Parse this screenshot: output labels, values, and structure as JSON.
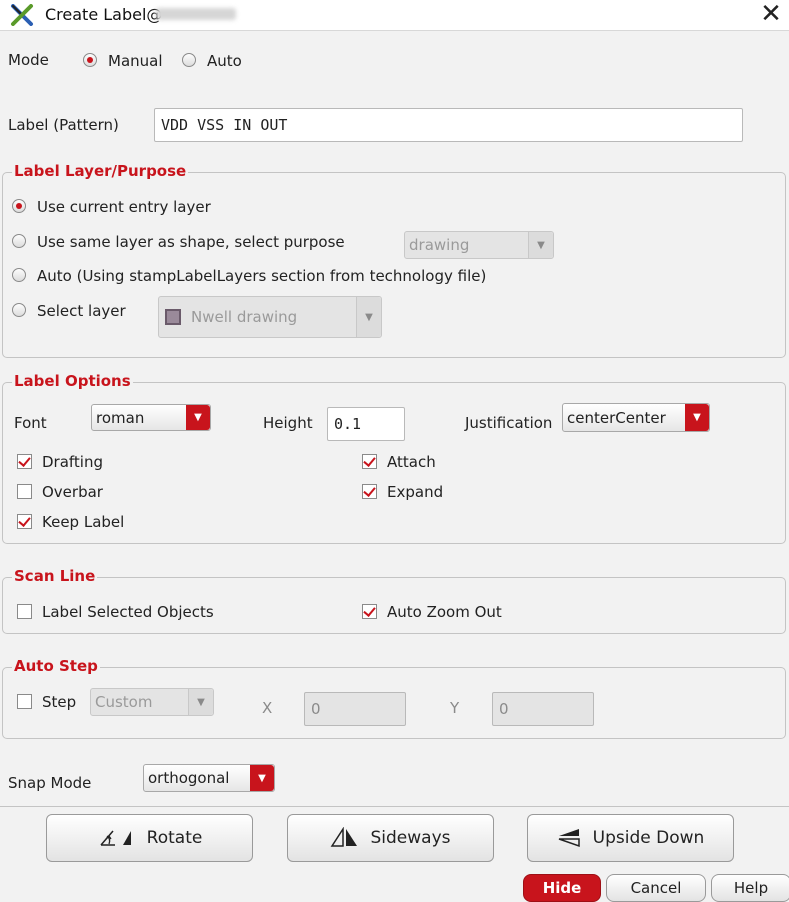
{
  "window": {
    "title": "Create Label@",
    "close_glyph": "✕"
  },
  "mode": {
    "label": "Mode",
    "options": [
      "Manual",
      "Auto"
    ],
    "selected": "Manual"
  },
  "label_pattern": {
    "label": "Label (Pattern)",
    "value": "VDD VSS IN OUT"
  },
  "layer_purpose": {
    "title": "Label Layer/Purpose",
    "options": [
      "Use current entry layer",
      "Use same layer as shape, select purpose",
      "Auto (Using stampLabelLayers section from technology file)",
      "Select layer"
    ],
    "selected": "Use current entry layer",
    "purpose_value": "drawing",
    "layer_value": "Nwell drawing"
  },
  "label_options": {
    "title": "Label Options",
    "font_label": "Font",
    "font_value": "roman",
    "height_label": "Height",
    "height_value": "0.1",
    "justification_label": "Justification",
    "justification_value": "centerCenter",
    "checks": {
      "drafting": {
        "label": "Drafting",
        "checked": true
      },
      "overbar": {
        "label": "Overbar",
        "checked": false
      },
      "keep_label": {
        "label": "Keep Label",
        "checked": true
      },
      "attach": {
        "label": "Attach",
        "checked": true
      },
      "expand": {
        "label": "Expand",
        "checked": true
      }
    }
  },
  "scan_line": {
    "title": "Scan Line",
    "label_selected": {
      "label": "Label Selected Objects",
      "checked": false
    },
    "auto_zoom": {
      "label": "Auto Zoom Out",
      "checked": true
    }
  },
  "auto_step": {
    "title": "Auto Step",
    "step": {
      "label": "Step",
      "checked": false
    },
    "step_mode": "Custom",
    "x_label": "X",
    "x_value": "0",
    "y_label": "Y",
    "y_value": "0"
  },
  "snap": {
    "label": "Snap Mode",
    "value": "orthogonal"
  },
  "buttons": {
    "rotate": "Rotate",
    "sideways": "Sideways",
    "upside_down": "Upside Down"
  },
  "footer": {
    "hide": "Hide",
    "cancel": "Cancel",
    "help": "Help"
  },
  "colors": {
    "accent": "#c8141c",
    "background": "#f2f2f2"
  }
}
